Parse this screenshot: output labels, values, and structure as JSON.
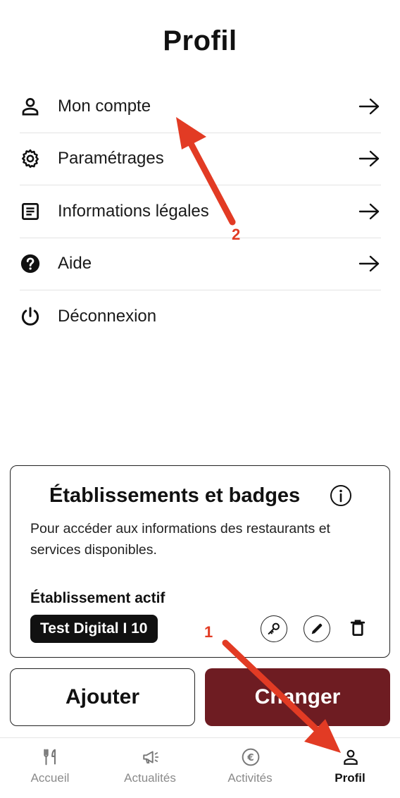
{
  "header": {
    "title": "Profil"
  },
  "menu": {
    "items": [
      {
        "label": "Mon compte",
        "icon": "person-icon"
      },
      {
        "label": "Paramétrages",
        "icon": "gear-icon"
      },
      {
        "label": "Informations légales",
        "icon": "document-icon"
      },
      {
        "label": "Aide",
        "icon": "help-icon"
      },
      {
        "label": "Déconnexion",
        "icon": "power-icon"
      }
    ]
  },
  "card": {
    "title": "Établissements et badges",
    "description": "Pour accéder aux informations des restaurants et services disponibles.",
    "active_label": "Établissement actif",
    "active_value": "Test Digital I 10"
  },
  "actions": {
    "add_label": "Ajouter",
    "change_label": "Changer"
  },
  "tabs": [
    {
      "label": "Accueil",
      "icon": "fork-knife-icon",
      "active": false
    },
    {
      "label": "Actualités",
      "icon": "megaphone-icon",
      "active": false
    },
    {
      "label": "Activités",
      "icon": "euro-icon",
      "active": false
    },
    {
      "label": "Profil",
      "icon": "person-icon",
      "active": true
    }
  ],
  "annotations": {
    "marker_1": "1",
    "marker_2": "2"
  },
  "colors": {
    "accent": "#6e1c22",
    "annotation": "#e23b24"
  }
}
